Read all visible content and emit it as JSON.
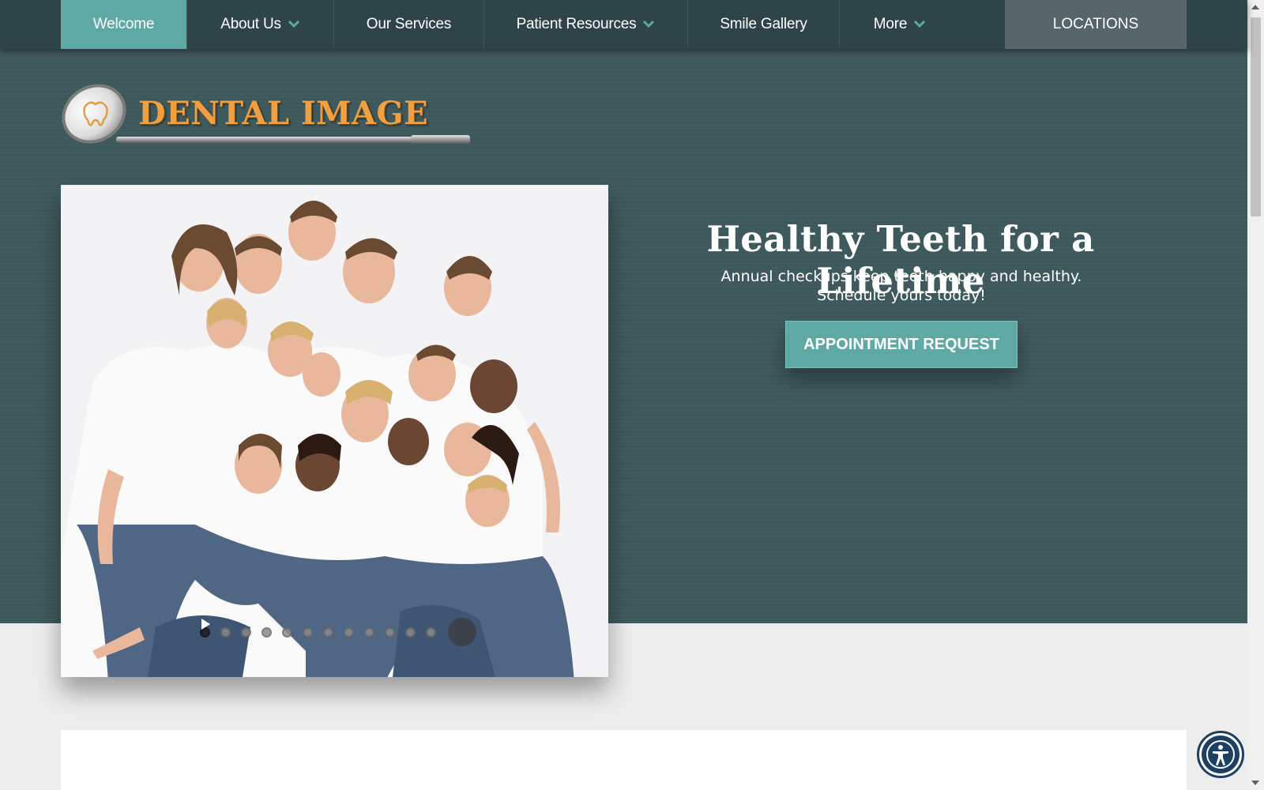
{
  "nav": {
    "items": [
      {
        "label": "Welcome",
        "active": true,
        "dropdown": false
      },
      {
        "label": "About Us",
        "active": false,
        "dropdown": true
      },
      {
        "label": "Our Services",
        "active": false,
        "dropdown": false
      },
      {
        "label": "Patient Resources",
        "active": false,
        "dropdown": true
      },
      {
        "label": "Smile Gallery",
        "active": false,
        "dropdown": false
      },
      {
        "label": "More",
        "active": false,
        "dropdown": true
      }
    ],
    "locations_label": "LOCATIONS"
  },
  "logo": {
    "text": "DENTAL IMAGE",
    "icon": "dental-mirror-tooth-icon"
  },
  "hero": {
    "headline": "Healthy Teeth for a Lifetime",
    "subline": "Annual checkups keep teeth happy and healthy. Schedule yours today!",
    "cta_label": "APPOINTMENT REQUEST"
  },
  "slider": {
    "slide_count": 12,
    "active_index": 0,
    "play_icon": "play-icon"
  },
  "colors": {
    "nav_bg": "#2e4448",
    "active_nav": "#5ea9a3",
    "locations_bg": "#566567",
    "hero_bg": "#405b5e",
    "accent": "#5ea9a3",
    "chevron": "#5ea9a3",
    "logo_text": "#f0a040",
    "page_bg": "#ededed",
    "a11y_blue": "#1c3f62"
  },
  "accessibility": {
    "icon": "accessibility-person-icon"
  }
}
